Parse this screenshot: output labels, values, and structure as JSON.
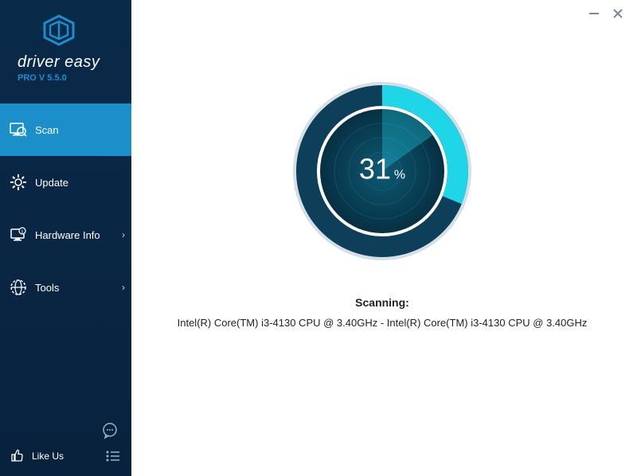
{
  "app": {
    "name": "driver easy",
    "version": "PRO V 5.5.0"
  },
  "sidebar": {
    "items": [
      {
        "label": "Scan",
        "expandable": false,
        "active": true
      },
      {
        "label": "Update",
        "expandable": false,
        "active": false
      },
      {
        "label": "Hardware Info",
        "expandable": true,
        "active": false
      },
      {
        "label": "Tools",
        "expandable": true,
        "active": false
      }
    ],
    "like_us": "Like Us"
  },
  "scan": {
    "percent": "31",
    "percent_suffix": "%",
    "status_label": "Scanning:",
    "device": "Intel(R) Core(TM) i3-4130 CPU @ 3.40GHz - Intel(R) Core(TM) i3-4130 CPU @ 3.40GHz"
  },
  "colors": {
    "accent": "#1b8fc9",
    "ring_outer": "#0d3f5a",
    "ring_inner": "#1acfe0"
  }
}
